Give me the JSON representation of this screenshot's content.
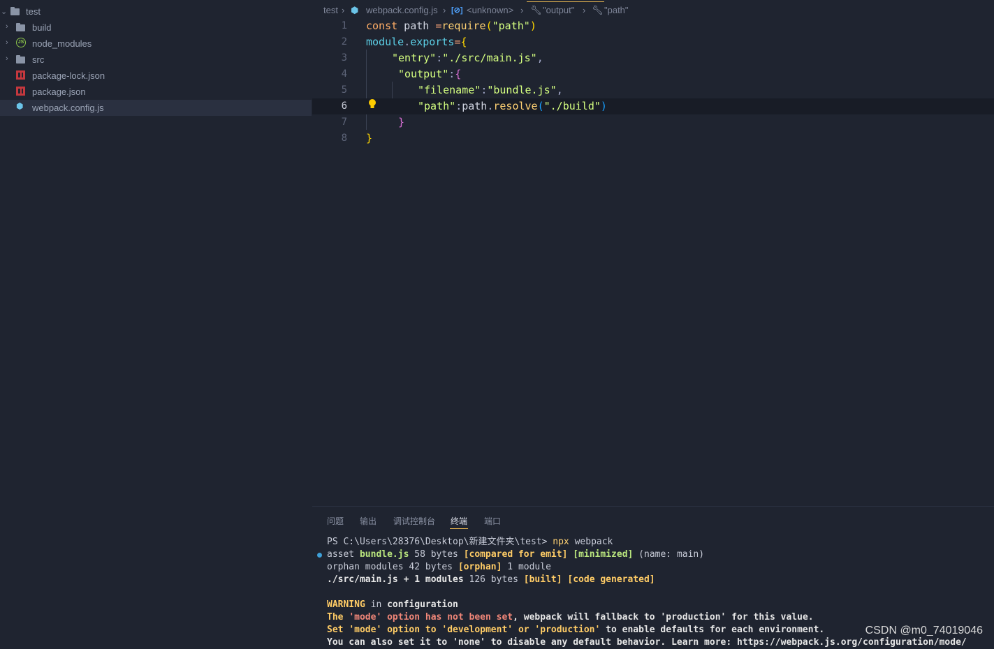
{
  "explorer": {
    "root": "test",
    "items": [
      {
        "label": "build",
        "icon": "folder-icon",
        "type": "folder"
      },
      {
        "label": "node_modules",
        "icon": "nodejs-icon",
        "type": "folder"
      },
      {
        "label": "src",
        "icon": "folder-icon",
        "type": "folder"
      },
      {
        "label": "package-lock.json",
        "icon": "npm-icon",
        "type": "file"
      },
      {
        "label": "package.json",
        "icon": "npm-icon",
        "type": "file"
      },
      {
        "label": "webpack.config.js",
        "icon": "webpack-icon",
        "type": "file",
        "selected": true
      }
    ]
  },
  "breadcrumb": {
    "folder": "test",
    "file": "webpack.config.js",
    "symbol1": "<unknown>",
    "symbol2": "\"output\"",
    "symbol3": "\"path\""
  },
  "editor": {
    "line_numbers": [
      "1",
      "2",
      "3",
      "4",
      "5",
      "6",
      "7",
      "8"
    ],
    "active_line": "6",
    "tokens": {
      "l1_const": "const",
      "l1_path": " path ",
      "l1_eq": "=",
      "l1_require": "require",
      "l1_open": "(",
      "l1_str": "\"path\"",
      "l1_close": ")",
      "l2_module": "module",
      "l2_dot": ".",
      "l2_exports": "exports",
      "l2_eq": "=",
      "l2_brace": "{",
      "l3_key": "\"entry\"",
      "l3_colon": ":",
      "l3_val": "\"./src/main.js\"",
      "l3_comma": ",",
      "l4_key": "\"output\"",
      "l4_colon": ":",
      "l4_brace": "{",
      "l5_key": "\"filename\"",
      "l5_colon": ":",
      "l5_val": "\"bundle.js\"",
      "l5_comma": ",",
      "l6_key": "\"path\"",
      "l6_colon": ":",
      "l6_obj": "path",
      "l6_dot": ".",
      "l6_fn": "resolve",
      "l6_open": "(",
      "l6_val": "\"./build\"",
      "l6_close": ")",
      "l7_brace": "}",
      "l8_brace": "}"
    }
  },
  "panel": {
    "tabs": [
      "问题",
      "输出",
      "调试控制台",
      "终端",
      "端口"
    ],
    "active_tab": "终端",
    "terminal": {
      "prompt": "PS C:\\Users\\28376\\Desktop\\新建文件夹\\test> ",
      "command": "npx",
      "command_arg": " webpack",
      "l2_a": "asset ",
      "l2_b": "bundle.js",
      "l2_c": " 58 bytes ",
      "l2_d": "[compared for emit]",
      "l2_e": " ",
      "l2_f": "[minimized]",
      "l2_g": " (name: main)",
      "l3_a": "orphan modules 42 bytes ",
      "l3_b": "[orphan]",
      "l3_c": " 1 module",
      "l4_a": "./src/main.js + 1 modules",
      "l4_b": " 126 bytes ",
      "l4_c": "[built]",
      "l4_d": " ",
      "l4_e": "[code generated]",
      "l6_a": "WARNING",
      "l6_b": " in ",
      "l6_c": "configuration",
      "l7_a": "The ",
      "l7_b": "'mode' option has not been set",
      "l7_c": ", webpack will fallback to 'production' for this value.",
      "l8_a": "Set ",
      "l8_b": "'mode' option to 'development' or 'production'",
      "l8_c": " to enable defaults for each environment.",
      "l9": "You can also set it to 'none' to disable any default behavior. Learn more: https://webpack.js.org/configuration/mode/"
    }
  },
  "watermark": "CSDN @m0_74019046",
  "colors": {
    "background": "#1f2430",
    "accent": "#e6b450",
    "keyword": "#ffad66",
    "string": "#d5ff80",
    "property": "#5ccfe6"
  }
}
